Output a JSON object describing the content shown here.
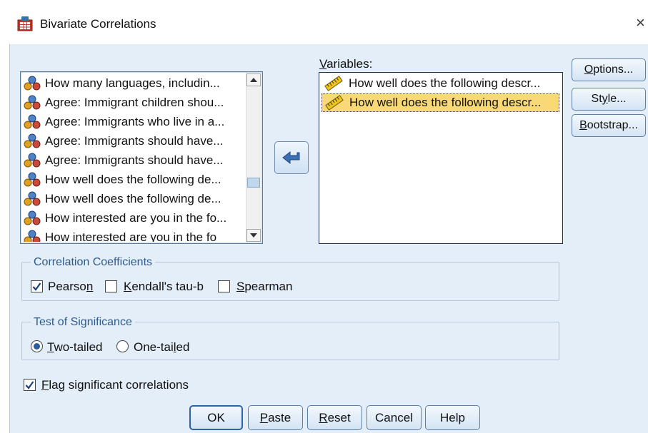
{
  "window": {
    "title": "Bivariate Correlations",
    "close_glyph": "×"
  },
  "source_list": {
    "items": [
      {
        "label": "How many languages, includin...",
        "icon": "nominal-variable-icon"
      },
      {
        "label": "Agree: Immigrant children shou...",
        "icon": "nominal-variable-icon"
      },
      {
        "label": "Agree: Immigrants who live in a...",
        "icon": "nominal-variable-icon"
      },
      {
        "label": "Agree: Immigrants should have...",
        "icon": "nominal-variable-icon"
      },
      {
        "label": "Agree: Immigrants should have...",
        "icon": "nominal-variable-icon"
      },
      {
        "label": "How well does the following de...",
        "icon": "nominal-variable-icon"
      },
      {
        "label": "How well does the following de...",
        "icon": "nominal-variable-icon"
      },
      {
        "label": "How interested are you in the fo...",
        "icon": "nominal-variable-icon"
      },
      {
        "label": "How interested are you in the fo",
        "icon": "nominal-variable-icon"
      }
    ]
  },
  "move_button": {
    "icon": "move-arrow-icon"
  },
  "variables": {
    "label_prefix": "V",
    "label_rest": "ariables:",
    "items": [
      {
        "label": "How well does the following descr...",
        "icon": "scale-variable-icon",
        "selected": false
      },
      {
        "label": "How well does the following descr...",
        "icon": "scale-variable-icon",
        "selected": true
      }
    ]
  },
  "side_buttons": {
    "options": {
      "key": "O",
      "rest": "ptions..."
    },
    "style": {
      "pre": "St",
      "key": "y",
      "rest": "le..."
    },
    "bootstrap": {
      "key": "B",
      "rest": "ootstrap..."
    }
  },
  "correlation_coefficients": {
    "title": "Correlation Coefficients",
    "pearson": {
      "pre": "Pearso",
      "key": "n",
      "checked": true
    },
    "kendall": {
      "key": "K",
      "rest": "endall's tau-b",
      "checked": false
    },
    "spearman": {
      "key": "S",
      "rest": "pearman",
      "checked": false
    }
  },
  "test_of_significance": {
    "title": "Test of Significance",
    "two_tailed": {
      "key": "T",
      "rest": "wo-tailed",
      "selected": true
    },
    "one_tailed": {
      "pre": "One-tai",
      "key": "l",
      "rest": "ed",
      "selected": false
    }
  },
  "flag": {
    "key": "F",
    "rest": "lag significant correlations",
    "checked": true
  },
  "bottom_buttons": {
    "ok": "OK",
    "paste": {
      "key": "P",
      "rest": "aste"
    },
    "reset": {
      "key": "R",
      "rest": "eset"
    },
    "cancel": "Cancel",
    "help": "Help"
  },
  "colors": {
    "dialog_background": "#e3eef9",
    "selection_highlight": "#f9d977",
    "group_title": "#2d5b8f",
    "checkmark": "#1c3f78"
  }
}
